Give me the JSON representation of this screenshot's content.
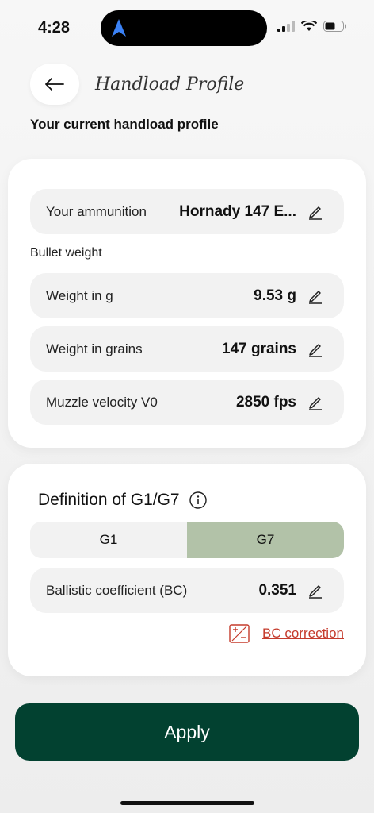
{
  "status_bar": {
    "time": "4:28"
  },
  "header": {
    "title": "Handload Profile",
    "subtitle": "Your current handload profile"
  },
  "ammo_card": {
    "ammunition_label": "Your ammunition",
    "ammunition_value": "Hornady 147 E...",
    "bullet_weight_label": "Bullet weight",
    "weight_g_label": "Weight in g",
    "weight_g_value": "9.53 g",
    "weight_grains_label": "Weight in grains",
    "weight_grains_value": "147 grains",
    "muzzle_label": "Muzzle velocity V0",
    "muzzle_value": "2850 fps"
  },
  "definition_card": {
    "title": "Definition of G1/G7",
    "options": [
      "G1",
      "G7"
    ],
    "selected": "G7",
    "bc_label": "Ballistic coefficient (BC)",
    "bc_value": "0.351",
    "bc_correction_link": "BC correction"
  },
  "apply_button": "Apply",
  "colors": {
    "primary": "#024130",
    "selected_segment": "#b2c2a8",
    "link": "#c53b2c"
  }
}
